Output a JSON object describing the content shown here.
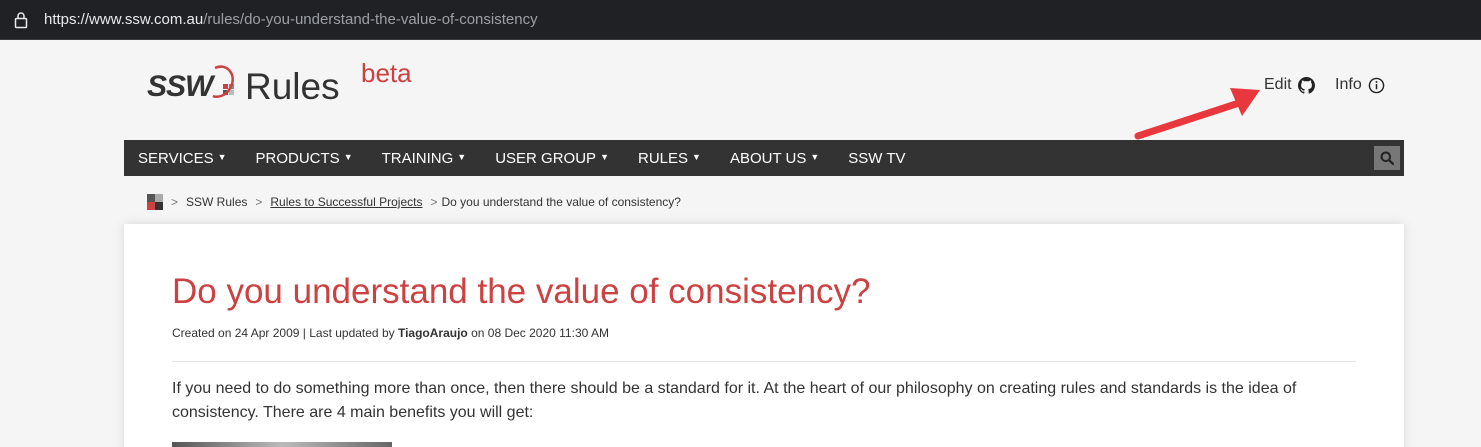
{
  "browser": {
    "url_scheme": "https://",
    "url_host": "www.ssw.com.au",
    "url_path": "/rules/do-you-understand-the-value-of-consistency"
  },
  "logo": {
    "ssw": "SSW",
    "rules": "Rules",
    "beta": "beta"
  },
  "topright": {
    "edit_label": "Edit",
    "info_label": "Info"
  },
  "nav": {
    "items": [
      {
        "label": "SERVICES",
        "dropdown": "chevron-down"
      },
      {
        "label": "PRODUCTS",
        "dropdown": "chevron-down"
      },
      {
        "label": "TRAINING",
        "dropdown": "chevron-down"
      },
      {
        "label": "USER GROUP",
        "dropdown": "chevron-down"
      },
      {
        "label": "RULES",
        "dropdown": "chevron-down"
      },
      {
        "label": "ABOUT US",
        "dropdown": "chevron-down"
      },
      {
        "label": "SSW TV"
      }
    ],
    "search_icon": "search-icon"
  },
  "breadcrumb": {
    "home": "SSW Rules",
    "category": "Rules to Successful Projects",
    "current": "Do you understand the value of consistency?"
  },
  "article": {
    "title": "Do you understand the value of consistency?",
    "created_prefix": "Created on 24 Apr 2009 | Last updated by ",
    "author": "TiagoAraujo",
    "updated_suffix": " on 08 Dec 2020 11:30 AM",
    "intro": "If you need to do something more than once, then there should be a standard for it. At the heart of our philosophy on creating rules and standards is the idea of consistency. There are 4 main benefits you will get:"
  },
  "colors": {
    "brand_red": "#cc4141",
    "nav_bg": "#333333",
    "annotation_arrow": "#e8383d"
  }
}
